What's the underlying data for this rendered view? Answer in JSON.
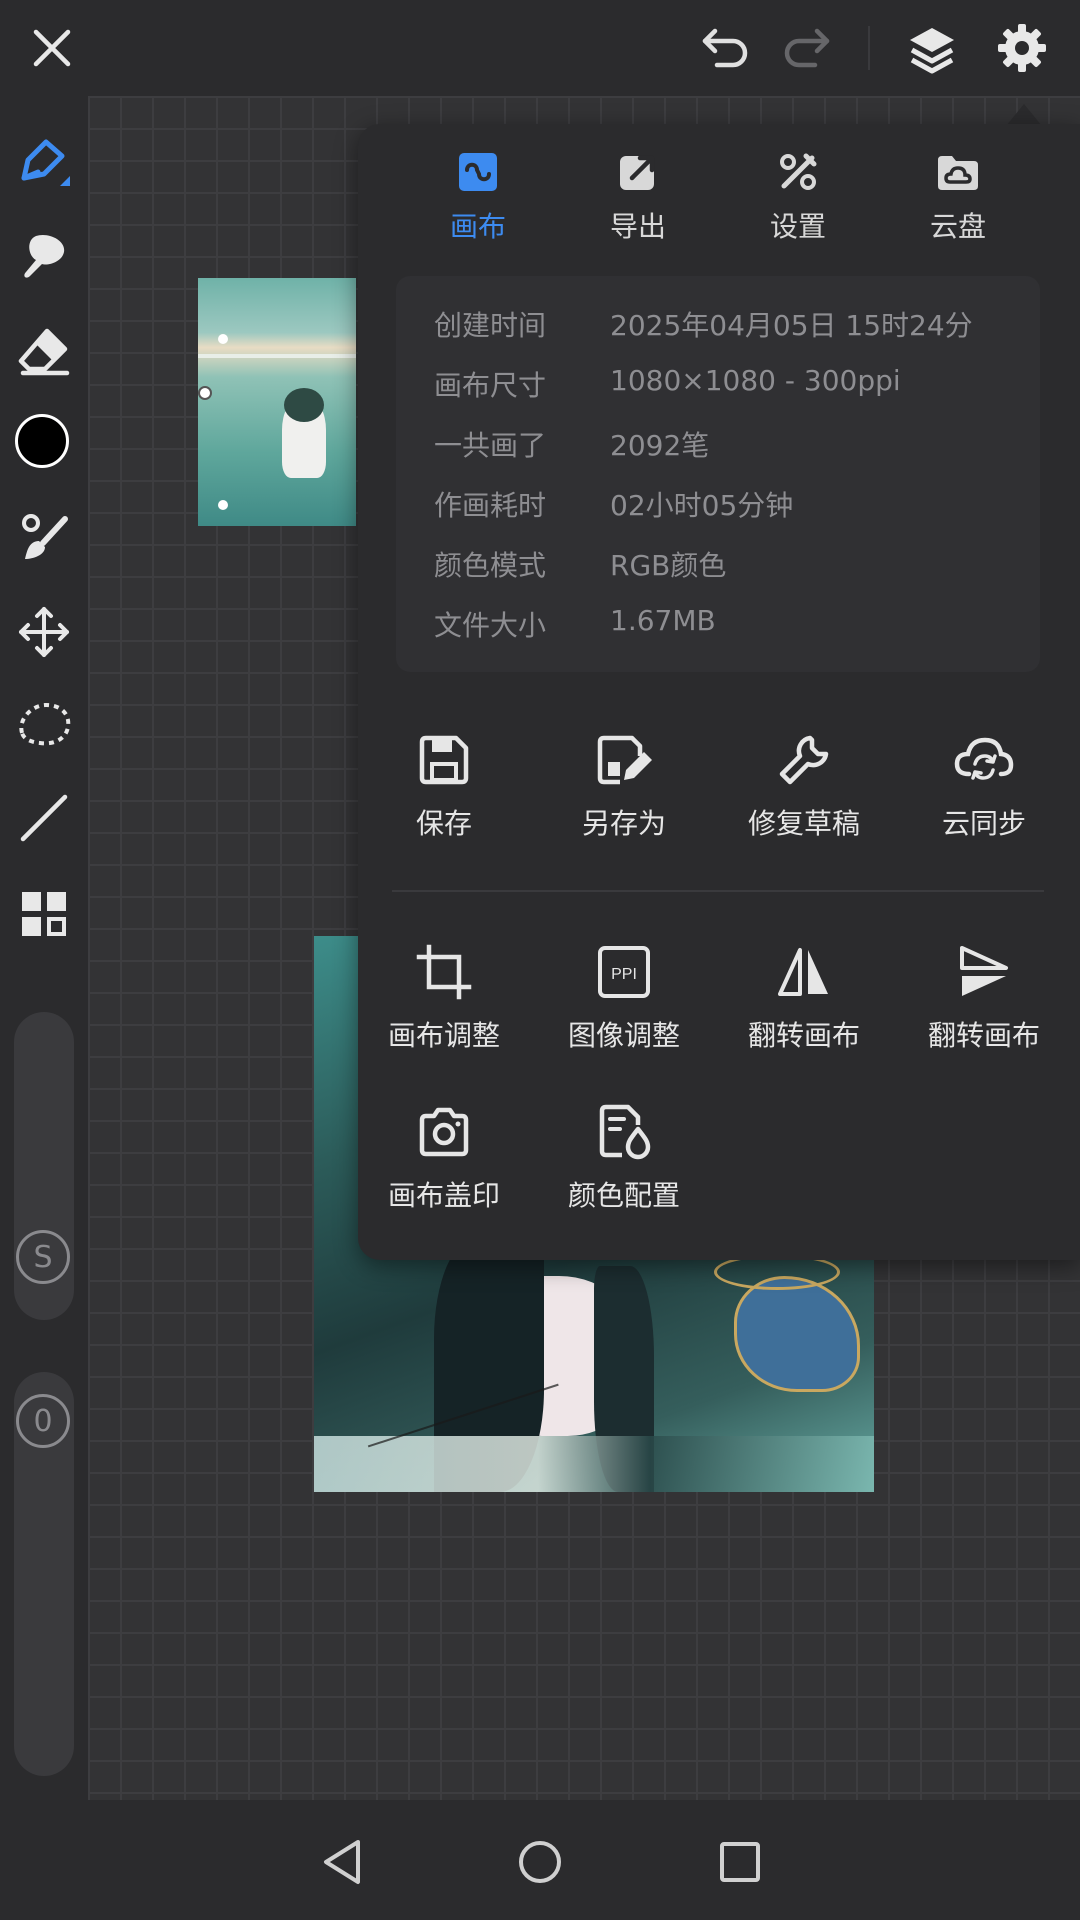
{
  "topbar": {
    "close": "close-icon",
    "undo": "undo-icon",
    "redo": "redo-icon",
    "layers": "layers-icon",
    "settings": "gear-icon"
  },
  "sidebar": {
    "tools": [
      "pen-icon",
      "smudge-icon",
      "eraser-icon",
      "color-swatch",
      "brush-adjust-icon",
      "move-icon",
      "lasso-icon",
      "line-icon",
      "grid-icon"
    ],
    "color": "#000000",
    "size_slider_label": "S",
    "opacity_slider_label": "0"
  },
  "menu": {
    "tabs": [
      {
        "label": "画布",
        "icon": "canvas-icon",
        "active": true
      },
      {
        "label": "导出",
        "icon": "export-icon",
        "active": false
      },
      {
        "label": "设置",
        "icon": "tools-icon",
        "active": false
      },
      {
        "label": "云盘",
        "icon": "cloud-drive-icon",
        "active": false
      }
    ],
    "info": [
      {
        "key": "创建时间",
        "value": "2025年04月05日 15时24分"
      },
      {
        "key": "画布尺寸",
        "value": "1080×1080 - 300ppi"
      },
      {
        "key": "一共画了",
        "value": "2092笔"
      },
      {
        "key": "作画耗时",
        "value": "02小时05分钟"
      },
      {
        "key": "颜色模式",
        "value": "RGB颜色"
      },
      {
        "key": "文件大小",
        "value": "1.67MB"
      }
    ],
    "actions_row1": [
      {
        "label": "保存",
        "icon": "save-icon"
      },
      {
        "label": "另存为",
        "icon": "save-as-icon"
      },
      {
        "label": "修复草稿",
        "icon": "wrench-icon"
      },
      {
        "label": "云同步",
        "icon": "cloud-sync-icon"
      }
    ],
    "actions_row2": [
      {
        "label": "画布调整",
        "icon": "crop-icon"
      },
      {
        "label": "图像调整",
        "icon": "ppi-icon",
        "icon_text": "PPI"
      },
      {
        "label": "翻转画布",
        "icon": "flip-horizontal-icon"
      },
      {
        "label": "翻转画布",
        "icon": "flip-vertical-icon"
      }
    ],
    "actions_row3": [
      {
        "label": "画布盖印",
        "icon": "camera-icon"
      },
      {
        "label": "颜色配置",
        "icon": "color-profile-icon"
      }
    ]
  },
  "navbar": {
    "back": "back-icon",
    "home": "home-icon",
    "recents": "recents-icon"
  },
  "colors": {
    "accent": "#3d8bf0",
    "panel_bg": "#2b2b2d",
    "info_bg": "#303033"
  }
}
